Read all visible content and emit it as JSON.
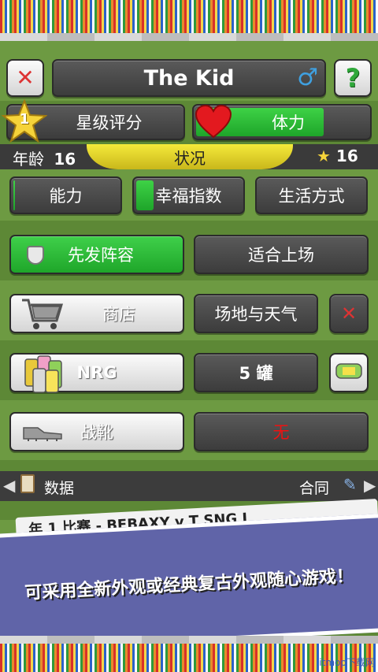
{
  "header": {
    "player_name": "The Kid",
    "gender_symbol": "♂",
    "close_symbol": "✕",
    "help_symbol": "?"
  },
  "stats": {
    "star_label": "星级评分",
    "star_level": "1",
    "stamina_label": "体力",
    "stamina_fill": 0.75
  },
  "info": {
    "age_label": "年龄",
    "age_value": "16",
    "condition_label": "状况",
    "potential_value": "16"
  },
  "tabs": [
    {
      "label": "能力",
      "fill": 0.06
    },
    {
      "label": "幸福指数",
      "fill": 0.2
    },
    {
      "label": "生活方式",
      "fill": 0
    }
  ],
  "lineup": {
    "starting_label": "先发阵容",
    "fit_label": "适合上场"
  },
  "shop": {
    "shop_label": "商店",
    "field_weather_label": "场地与天气",
    "close_symbol": "✕"
  },
  "nrg": {
    "label": "NRG",
    "count_label": "5 罐"
  },
  "boots": {
    "label": "战靴",
    "value": "无"
  },
  "footer": {
    "data_label": "数据",
    "contract_label": "合同"
  },
  "match_strip": {
    "text": "年 1     比赛 - BEBAXY v T SNG I"
  },
  "banner": {
    "text": "可采用全新外观或经典复古外观随心游戏！"
  },
  "watermark": {
    "text": "itmop下载网"
  },
  "colors": {
    "accent_green": "#22aa2e",
    "condition_yellow": "#f0e030",
    "danger_red": "#d33333",
    "banner_purple": "#6064a8"
  }
}
